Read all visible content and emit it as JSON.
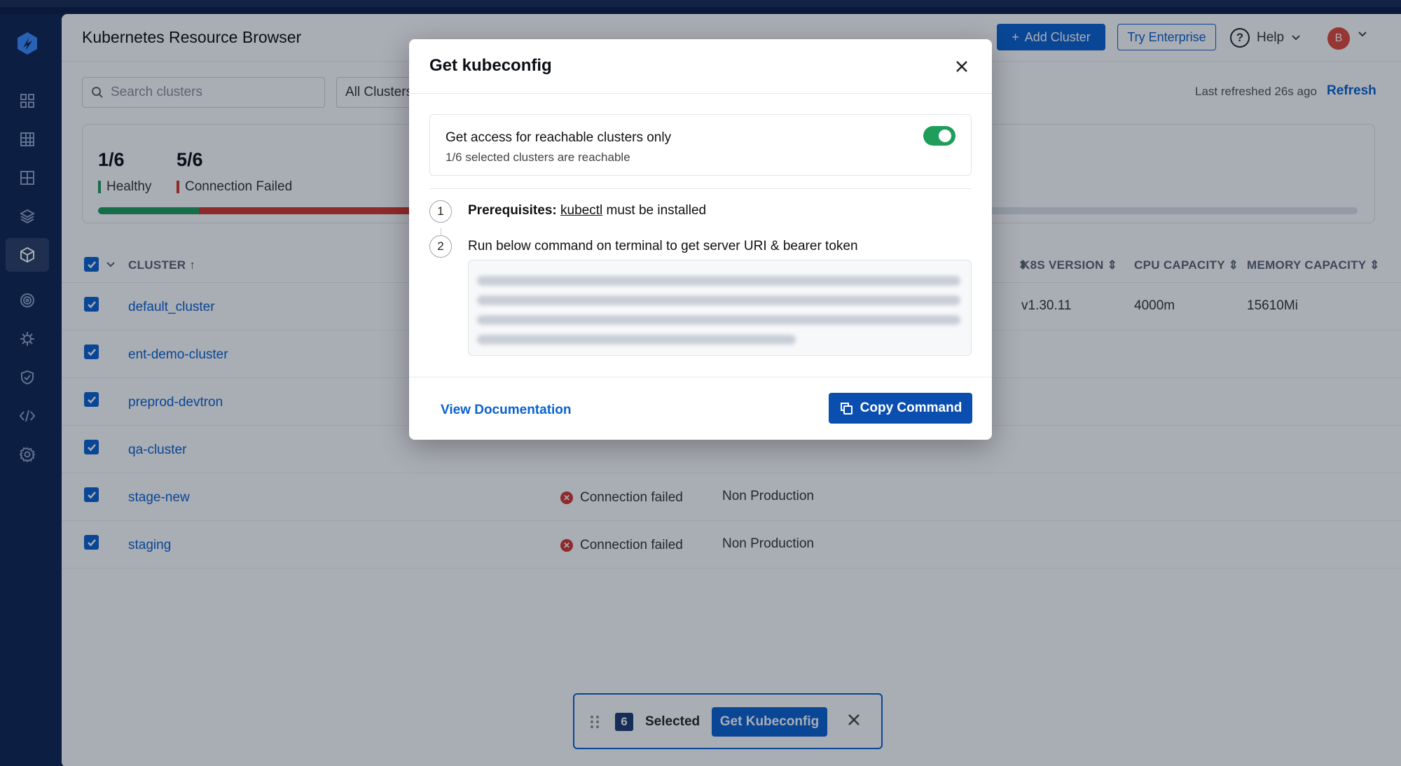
{
  "colors": {
    "accent": "#0a62d0",
    "healthy": "#1e9e5a",
    "failed": "#d6362d",
    "sidebar": "#0f2451"
  },
  "sidebar": {
    "logo": "devtron-logo-icon",
    "items": [
      {
        "icon": "apps-grid-icon"
      },
      {
        "icon": "table-grid-icon"
      },
      {
        "icon": "layout-icon"
      },
      {
        "icon": "stack-icon"
      },
      {
        "icon": "cube-icon",
        "active": true
      },
      {
        "icon": "target-icon"
      },
      {
        "icon": "gear-wheel-icon"
      },
      {
        "icon": "shield-icon"
      },
      {
        "icon": "code-icon"
      },
      {
        "icon": "settings-icon"
      }
    ]
  },
  "header": {
    "title": "Kubernetes Resource Browser",
    "add_cluster": "Add Cluster",
    "try_enterprise": "Try Enterprise",
    "help": "Help",
    "avatar_initial": "B"
  },
  "toolbar": {
    "search_placeholder": "Search clusters",
    "filter_value": "All Clusters",
    "last_refreshed": "Last refreshed 26s ago",
    "refresh": "Refresh"
  },
  "summary": {
    "healthy_count": "1/6",
    "healthy_label": "Healthy",
    "failed_count": "5/6",
    "failed_label": "Connection Failed"
  },
  "table": {
    "headers": {
      "cluster": "CLUSTER",
      "k8s_version": "K8S VERSION",
      "cpu_capacity": "CPU CAPACITY",
      "memory_capacity": "MEMORY CAPACITY"
    },
    "rows": [
      {
        "name": "default_cluster",
        "status": "",
        "env": "",
        "k8s": "v1.30.11",
        "cpu": "4000m",
        "mem": "15610Mi"
      },
      {
        "name": "ent-demo-cluster",
        "status": "",
        "env": "",
        "k8s": "",
        "cpu": "",
        "mem": ""
      },
      {
        "name": "preprod-devtron",
        "status": "",
        "env": "",
        "k8s": "",
        "cpu": "",
        "mem": ""
      },
      {
        "name": "qa-cluster",
        "status": "",
        "env": "",
        "k8s": "",
        "cpu": "",
        "mem": ""
      },
      {
        "name": "stage-new",
        "status": "Connection failed",
        "env": "Non Production",
        "k8s": "",
        "cpu": "",
        "mem": ""
      },
      {
        "name": "staging",
        "status": "Connection failed",
        "env": "Non Production",
        "k8s": "",
        "cpu": "",
        "mem": ""
      }
    ]
  },
  "bulk": {
    "count": "6",
    "selected_label": "Selected",
    "action": "Get Kubeconfig"
  },
  "modal": {
    "title": "Get kubeconfig",
    "access_title": "Get access for reachable clusters only",
    "access_sub": "1/6 selected clusters are reachable",
    "toggle_on": true,
    "step1_num": "1",
    "step1_bold": "Prerequisites:",
    "step1_link": "kubectl",
    "step1_rest": "must be installed",
    "step2_num": "2",
    "step2_text": "Run below command on terminal to get server URI & bearer token",
    "view_docs": "View Documentation",
    "copy_command": "Copy Command"
  }
}
